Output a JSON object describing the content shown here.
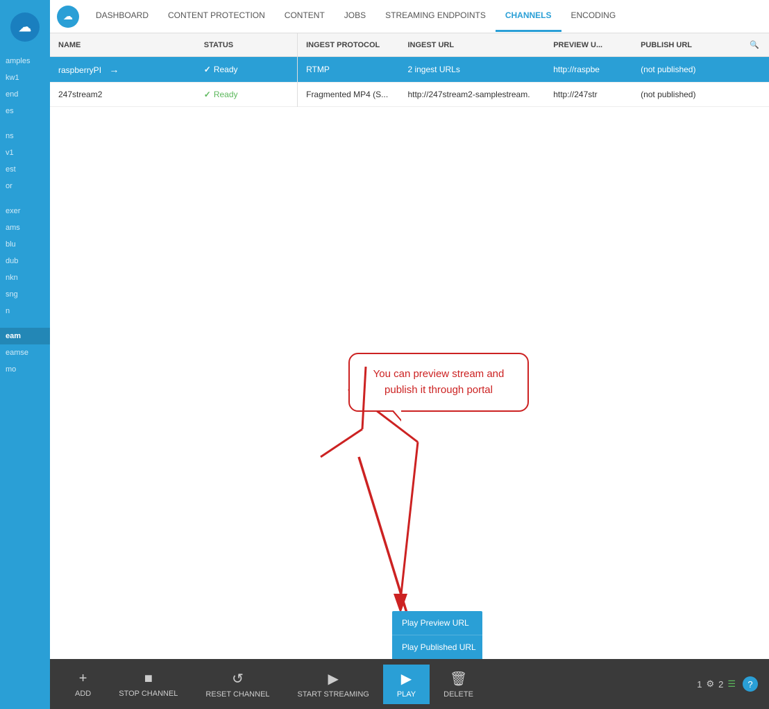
{
  "sidebar": {
    "items": [
      {
        "label": "amples"
      },
      {
        "label": "kw1"
      },
      {
        "label": "end"
      },
      {
        "label": "es"
      },
      {
        "label": "ns"
      },
      {
        "label": "v1"
      },
      {
        "label": "est"
      },
      {
        "label": "or"
      },
      {
        "label": "exer"
      },
      {
        "label": "ams"
      },
      {
        "label": "blu"
      },
      {
        "label": "dub"
      },
      {
        "label": "nkn"
      },
      {
        "label": "sng"
      },
      {
        "label": "n"
      },
      {
        "label": "eam",
        "active": true
      },
      {
        "label": "eamse"
      },
      {
        "label": "mo"
      }
    ]
  },
  "topnav": {
    "items": [
      {
        "label": "DASHBOARD"
      },
      {
        "label": "CONTENT PROTECTION"
      },
      {
        "label": "CONTENT"
      },
      {
        "label": "JOBS"
      },
      {
        "label": "STREAMING ENDPOINTS"
      },
      {
        "label": "CHANNELS",
        "active": true
      },
      {
        "label": "ENCODING"
      }
    ]
  },
  "table": {
    "columns": [
      "NAME",
      "STATUS",
      "INGEST PROTOCOL",
      "INGEST URL",
      "PREVIEW U...",
      "PUBLISH URL"
    ],
    "rows": [
      {
        "name": "raspberryPI",
        "status": "Ready",
        "ingest_protocol": "RTMP",
        "ingest_url": "2 ingest URLs",
        "preview_url": "http://raspbe",
        "publish_url": "(not published)",
        "selected": true
      },
      {
        "name": "247stream2",
        "status": "Ready",
        "ingest_protocol": "Fragmented MP4 (S...",
        "ingest_url": "http://247stream2-samplestream.",
        "preview_url": "http://247str",
        "publish_url": "(not published)",
        "selected": false
      }
    ]
  },
  "callout": {
    "text": "You can preview stream and publish it through portal"
  },
  "play_dropdown": {
    "items": [
      "Play Preview URL",
      "Play Published URL"
    ]
  },
  "toolbar": {
    "buttons": [
      {
        "label": "ADD",
        "icon": "+"
      },
      {
        "label": "STOP CHANNEL",
        "icon": "■"
      },
      {
        "label": "RESET CHANNEL",
        "icon": "↺"
      },
      {
        "label": "START STREAMING",
        "icon": "▶"
      },
      {
        "label": "PLAY",
        "icon": "▶",
        "active": true
      },
      {
        "label": "DELETE",
        "icon": "🗑"
      }
    ],
    "right": {
      "number1": "1",
      "number2": "2",
      "help_icon": "?"
    }
  }
}
